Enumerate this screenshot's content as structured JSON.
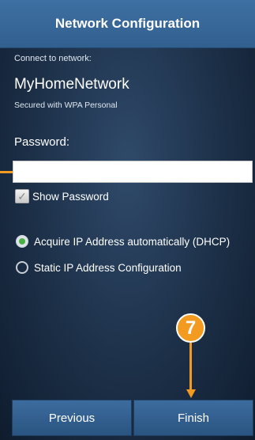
{
  "header": {
    "title": "Network Configuration"
  },
  "connection": {
    "connect_label": "Connect to network:",
    "network_name": "MyHomeNetwork",
    "security": "Secured with WPA Personal"
  },
  "password": {
    "label": "Password:",
    "value": ""
  },
  "show_password": {
    "label": "Show Password",
    "checked": true
  },
  "ip_options": [
    {
      "label": "Acquire IP Address automatically (DHCP)",
      "selected": true
    },
    {
      "label": "Static IP Address Configuration",
      "selected": false
    }
  ],
  "annotation": {
    "step_number": "7",
    "color": "#f39a21"
  },
  "buttons": {
    "previous": "Previous",
    "finish": "Finish"
  },
  "colors": {
    "header": "#3a6a9c",
    "accent_green": "#4bb043",
    "callout": "#f39a21"
  }
}
